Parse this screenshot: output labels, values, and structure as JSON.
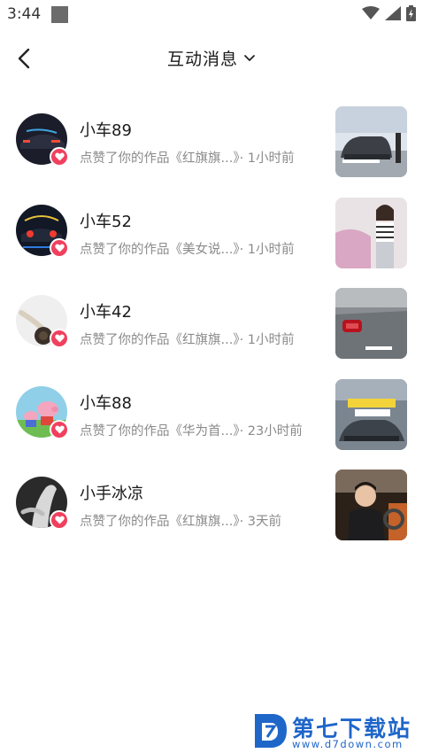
{
  "status_bar": {
    "time": "3:44"
  },
  "header": {
    "title": "互动消息"
  },
  "items": [
    {
      "name": "小车89",
      "desc": "点赞了你的作品《红旗旗...》· 1小时前"
    },
    {
      "name": "小车52",
      "desc": "点赞了你的作品《美女说...》· 1小时前"
    },
    {
      "name": "小车42",
      "desc": "点赞了你的作品《红旗旗...》· 1小时前"
    },
    {
      "name": "小车88",
      "desc": "点赞了你的作品《华为首...》· 23小时前"
    },
    {
      "name": "小手冰凉",
      "desc": "点赞了你的作品《红旗旗...》· 3天前"
    }
  ],
  "watermark": {
    "text": "第七下载站",
    "url": "www.d7down.com"
  },
  "colors": {
    "heart": "#f0405e",
    "watermark": "#1f66c9"
  },
  "icons": [
    "back-arrow-icon",
    "chevron-down-icon",
    "heart-icon",
    "wifi-icon",
    "signal-icon",
    "battery-icon"
  ]
}
